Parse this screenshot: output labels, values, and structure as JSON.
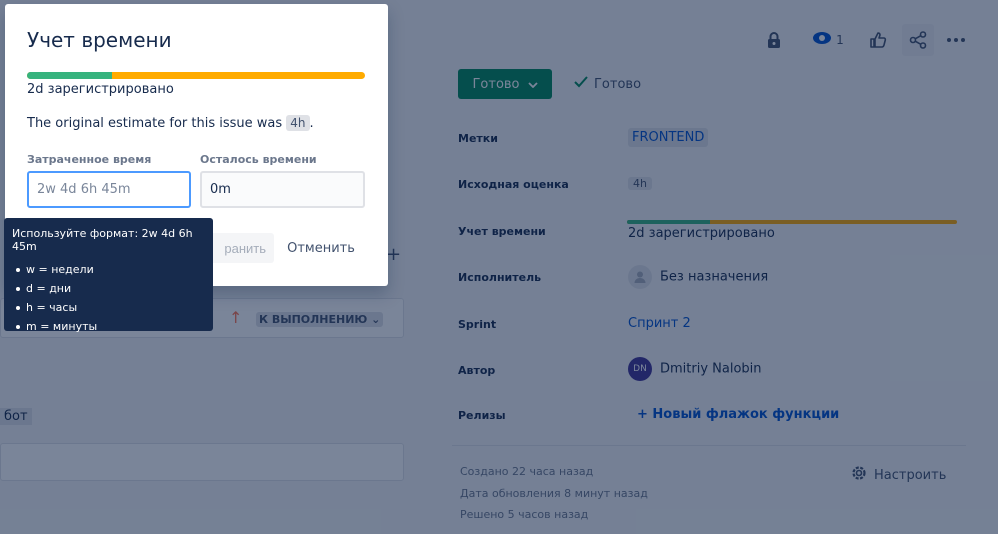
{
  "header_actions": {
    "watch_count": "1",
    "icons": [
      "lock-icon",
      "eye-icon",
      "thumbs-up-icon",
      "share-icon",
      "more-icon"
    ]
  },
  "status": {
    "button_label": "Готово",
    "resolution_label": "Готово"
  },
  "fields": {
    "labels_label": "Метки",
    "labels_value": "FRONTEND",
    "original_estimate_label": "Исходная оценка",
    "original_estimate_value": "4h",
    "time_tracking_label": "Учет времени",
    "time_tracking_logged": "2d зарегистрировано",
    "time_tracking_progress": 0.25,
    "assignee_label": "Исполнитель",
    "assignee_value": "Без назначения",
    "sprint_label": "Sprint",
    "sprint_value": "Спринт 2",
    "reporter_label": "Автор",
    "reporter_initials": "DN",
    "reporter_name": "Dmitriy Nalobin",
    "releases_label": "Релизы",
    "releases_value": "+ Новый флажок функции"
  },
  "meta": {
    "created": "Создано 22 часа назад",
    "updated": "Дата обновления 8 минут назад",
    "resolved": "Решено 5 часов назад",
    "configure_label": "Настроить"
  },
  "left_panel": {
    "todo_status": "К ВЫПОЛНЕНИЮ",
    "bot_text": "бот"
  },
  "dialog": {
    "title": "Учет времени",
    "progress": 0.25,
    "logged": "2d зарегистрировано",
    "original_prefix": "The original estimate for this issue was",
    "original_value": "4h",
    "original_suffix": ".",
    "spent_label": "Затраченное время",
    "spent_placeholder": "2w 4d 6h 45m",
    "remaining_label": "Осталось времени",
    "remaining_value": "0m",
    "save_label": "ранить",
    "cancel_label": "Отменить"
  },
  "tooltip": {
    "title": "Используйте формат: 2w 4d 6h 45m",
    "items": [
      "w = недели",
      "d = дни",
      "h = часы",
      "m = минуты"
    ]
  },
  "colors": {
    "accent_green": "#00875a",
    "progress_logged": "#36b37e",
    "progress_remaining": "#ffab00",
    "focus_border": "#4c9aff",
    "tooltip_bg": "#172b4d",
    "link": "#0052cc"
  }
}
